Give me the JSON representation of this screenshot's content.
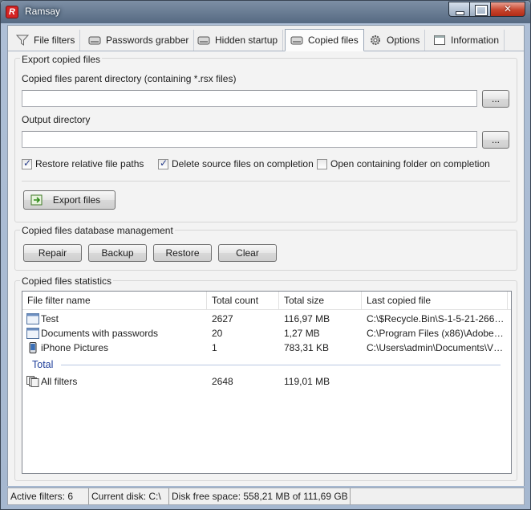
{
  "window": {
    "title": "Ramsay",
    "app_icon_letter": "R"
  },
  "tabs": [
    {
      "label": "File filters",
      "icon": "funnel-icon"
    },
    {
      "label": "Passwords grabber",
      "icon": "drive-icon"
    },
    {
      "label": "Hidden startup",
      "icon": "drive-icon"
    },
    {
      "label": "Copied files",
      "icon": "drive-icon"
    },
    {
      "label": "Options",
      "icon": "gear-icon"
    },
    {
      "label": "Information",
      "icon": "window-icon"
    }
  ],
  "active_tab": "Copied files",
  "export": {
    "group_title": "Export copied files",
    "parent_dir_label": "Copied files parent directory (containing *.rsx files)",
    "parent_dir_value": "",
    "output_dir_label": "Output directory",
    "output_dir_value": "",
    "browse_label": "...",
    "restore_paths_label": "Restore relative file paths",
    "restore_paths_checked": true,
    "delete_source_label": "Delete source files on completion",
    "delete_source_checked": true,
    "open_folder_label": "Open containing folder on completion",
    "open_folder_checked": false,
    "export_button_label": "Export files"
  },
  "database": {
    "group_title": "Copied files database management",
    "repair_label": "Repair",
    "backup_label": "Backup",
    "restore_label": "Restore",
    "clear_label": "Clear"
  },
  "statistics": {
    "group_title": "Copied files statistics",
    "columns": [
      "File filter name",
      "Total count",
      "Total size",
      "Last copied file"
    ],
    "rows": [
      {
        "name": "Test",
        "count": "2627",
        "size": "116,97 MB",
        "last": "C:\\$Recycle.Bin\\S-1-5-21-2665...",
        "icon": "folder-window-icon"
      },
      {
        "name": "Documents with passwords",
        "count": "20",
        "size": "1,27 MB",
        "last": "C:\\Program Files (x86)\\Adobe\\A...",
        "icon": "folder-window-icon"
      },
      {
        "name": "iPhone Pictures",
        "count": "1",
        "size": "783,31 KB",
        "last": "C:\\Users\\admin\\Documents\\Vnik...",
        "icon": "phone-icon"
      }
    ],
    "total_group_label": "Total",
    "total_row": {
      "name": "All filters",
      "count": "2648",
      "size": "119,01 MB",
      "last": "",
      "icon": "stack-icon"
    }
  },
  "status": {
    "active_filters": "Active filters: 6",
    "current_disk": "Current disk: C:\\",
    "disk_free": "Disk free space: 558,21 MB of 111,69 GB"
  }
}
